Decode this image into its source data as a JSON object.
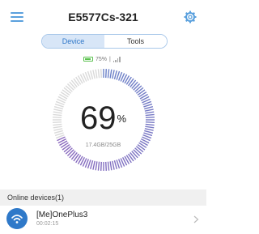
{
  "header": {
    "title": "E5577Cs-321",
    "menu_icon": "hamburger-menu-icon",
    "settings_icon": "gear-icon"
  },
  "tabs": [
    {
      "label": "Device",
      "active": true
    },
    {
      "label": "Tools",
      "active": false
    }
  ],
  "status": {
    "battery_percent": "75%",
    "separator": "|",
    "battery_level": 0.75
  },
  "gauge": {
    "value": "69",
    "unit": "%",
    "usage": "17.4GB/25GB",
    "fraction": 0.69
  },
  "online_devices": {
    "section_label": "Online devices(1)",
    "items": [
      {
        "name": "[Me]OnePlus3",
        "duration": "00:02:15",
        "icon": "wifi-icon"
      }
    ]
  },
  "colors": {
    "accent": "#2f79c9",
    "tab_active_bg": "#d8e6f7",
    "gauge_used": "#6b82c8",
    "gauge_unused": "#d9d9d9",
    "battery": "#59c14d"
  }
}
